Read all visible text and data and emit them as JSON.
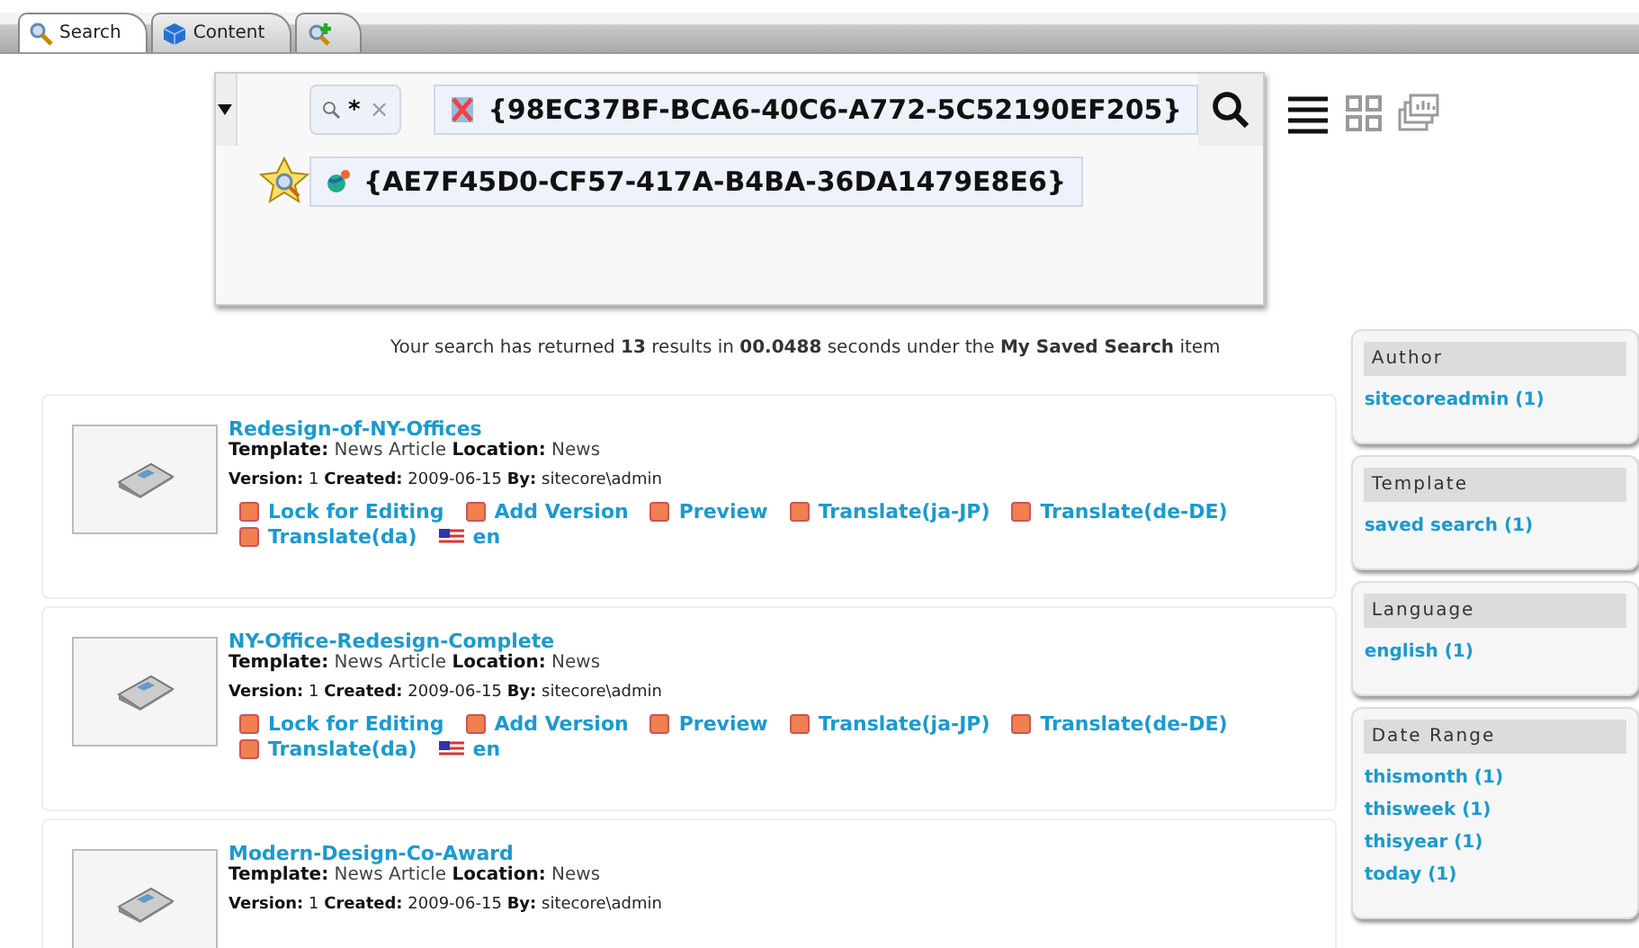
{
  "tabs": [
    {
      "kind": "search",
      "label": "Search",
      "selected": true
    },
    {
      "kind": "content",
      "label": "Content",
      "selected": false
    },
    {
      "kind": "add",
      "selected": false
    }
  ],
  "search": {
    "filter": {
      "text": "*",
      "remove": "×"
    },
    "tokens": [
      {
        "kind": "template",
        "text": "{98EC37BF-BCA6-40C6-A772-5C52190EF205}"
      },
      {
        "kind": "location",
        "text": "{AE7F45D0-CF57-417A-B4BA-36DA1479E8E6}"
      }
    ]
  },
  "views": [
    {
      "kind": "list",
      "selected": true
    },
    {
      "kind": "grid",
      "selected": false
    },
    {
      "kind": "gallery",
      "selected": false
    }
  ],
  "summary": "Your search has returned **13** results in **00.0488** seconds under the **My Saved Search** item",
  "results": [
    {
      "title": "Redesign-of-NY-Offices",
      "meta": "**Template:** News Article **Location:** News",
      "info": "**Version:** 1 **Created:** 2009-06-15 **By:** sitecore\\admin",
      "actions": [
        {
          "kind": "action",
          "label": "Lock for Editing"
        },
        {
          "kind": "action",
          "label": "Add Version"
        },
        {
          "kind": "action",
          "label": "Preview"
        },
        {
          "kind": "action",
          "label": "Translate(ja-JP)"
        },
        {
          "kind": "action",
          "label": "Translate(de-DE)"
        },
        {
          "kind": "action",
          "label": "Translate(da)"
        },
        {
          "kind": "language",
          "label": "en"
        }
      ]
    },
    {
      "title": "NY-Office-Redesign-Complete",
      "meta": "**Template:** News Article **Location:** News",
      "info": "**Version:** 1 **Created:** 2009-06-15 **By:** sitecore\\admin",
      "actions": [
        {
          "kind": "action",
          "label": "Lock for Editing"
        },
        {
          "kind": "action",
          "label": "Add Version"
        },
        {
          "kind": "action",
          "label": "Preview"
        },
        {
          "kind": "action",
          "label": "Translate(ja-JP)"
        },
        {
          "kind": "action",
          "label": "Translate(de-DE)"
        },
        {
          "kind": "action",
          "label": "Translate(da)"
        },
        {
          "kind": "language",
          "label": "en"
        }
      ]
    },
    {
      "title": "Modern-Design-Co-Award",
      "meta": "**Template:** News Article **Location:** News",
      "info": "**Version:** 1 **Created:** 2009-06-15 **By:** sitecore\\admin"
    }
  ],
  "facets": [
    {
      "title": "Author",
      "items": [
        "sitecoreadmin (1)"
      ]
    },
    {
      "title": "Template",
      "items": [
        "saved search (1)"
      ]
    },
    {
      "title": "Language",
      "items": [
        "english (1)"
      ]
    },
    {
      "title": "Date Range",
      "items": [
        "thismonth (1)",
        "thisweek (1)",
        "thisyear (1)",
        "today (1)"
      ]
    }
  ]
}
